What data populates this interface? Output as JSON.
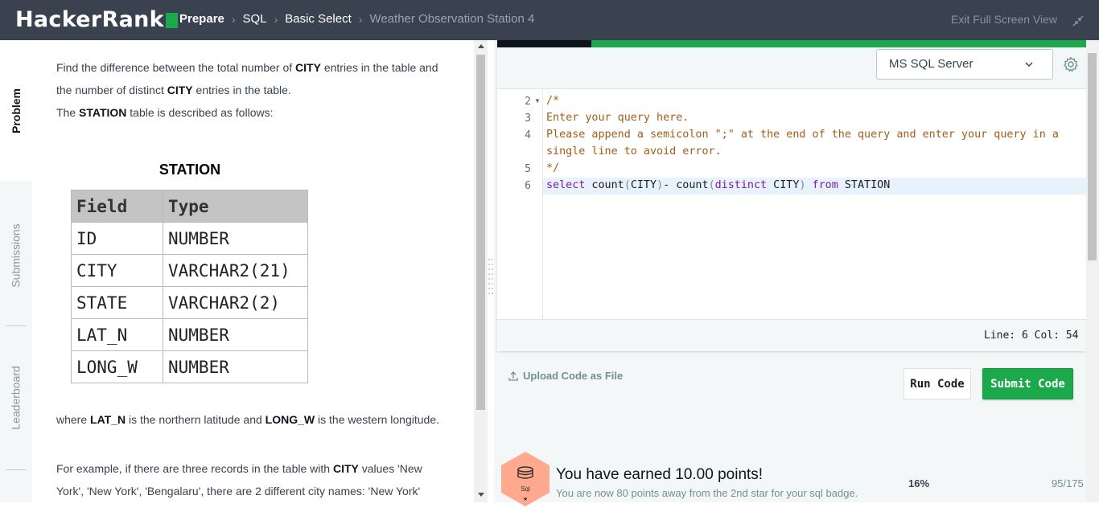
{
  "header": {
    "logo_text": "HackerRank",
    "breadcrumbs": [
      "Prepare",
      "SQL",
      "Basic Select",
      "Weather Observation Station 4"
    ],
    "exit_fullscreen": "Exit Full Screen View"
  },
  "tabs": {
    "problem": "Problem",
    "submissions": "Submissions",
    "leaderboard": "Leaderboard"
  },
  "problem": {
    "p1_a": "Find the difference between the total number of ",
    "p1_b": "CITY",
    "p1_c": " entries in the table and the number of distinct ",
    "p1_d": "CITY",
    "p1_e": " entries in the table.",
    "p2_a": "The ",
    "p2_b": "STATION",
    "p2_c": " table is described as follows:",
    "table_title": "STATION",
    "table_headers": [
      "Field",
      "Type"
    ],
    "table_rows": [
      [
        "ID",
        "NUMBER"
      ],
      [
        "CITY",
        "VARCHAR2(21)"
      ],
      [
        "STATE",
        "VARCHAR2(2)"
      ],
      [
        "LAT_N",
        "NUMBER"
      ],
      [
        "LONG_W",
        "NUMBER"
      ]
    ],
    "p3_a": "where ",
    "p3_b": "LAT_N",
    "p3_c": " is the northern latitude and ",
    "p3_d": "LONG_W",
    "p3_e": " is the western longitude.",
    "p4_a": "For example, if there are three records in the table with ",
    "p4_b": "CITY",
    "p4_c": " values 'New York', 'New York', 'Bengalaru', there are 2 different city names: 'New York'"
  },
  "editor": {
    "language": "MS SQL Server",
    "line_numbers": [
      "2",
      "3",
      "4",
      "5",
      "6"
    ],
    "code_lines": [
      "/*",
      "Enter your query here.",
      "Please append a semicolon \";\" at the end of the query and enter your query in a",
      "single line to avoid error.",
      "*/"
    ],
    "query": {
      "k1": "select",
      "t1": " count",
      "p1": "(",
      "t2": "CITY",
      "p2": ")",
      "t3": "- count",
      "p3": "(",
      "k2": "distinct",
      "t4": " CITY",
      "p4": ")",
      "k3": " from",
      "t5": " STATION"
    },
    "status": "Line: 6 Col: 54"
  },
  "actions": {
    "upload": "Upload Code as File",
    "run": "Run Code",
    "submit": "Submit Code"
  },
  "progress": {
    "badge_label": "Sql",
    "title": "You have earned 10.00 points!",
    "subtitle": "You are now 80 points away from the 2nd star for your sql badge.",
    "percent": "16%",
    "points": "95/175"
  },
  "colors": {
    "topbar": "#39424e",
    "brand_green": "#1ba94c",
    "badge_orange": "#ffa98f"
  }
}
